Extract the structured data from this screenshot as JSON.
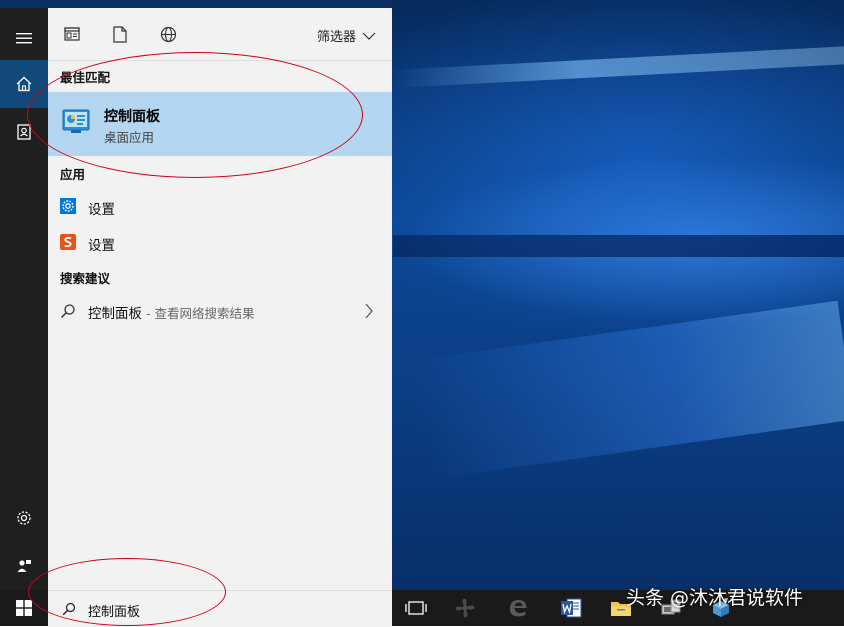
{
  "panel": {
    "filter_label": "筛选器",
    "best_match_heading": "最佳匹配",
    "apps_heading": "应用",
    "suggest_heading": "搜索建议"
  },
  "best_match": {
    "title": "控制面板",
    "subtitle": "桌面应用"
  },
  "apps": [
    {
      "label": "设置",
      "icon": "gear-icon",
      "color": "#0078d7"
    },
    {
      "label": "设置",
      "icon": "sogou-icon",
      "color": "#e8521d"
    }
  ],
  "suggestion": {
    "query": "控制面板",
    "hint": " - 查看网络搜索结果"
  },
  "search": {
    "value": "控制面板"
  },
  "watermark": {
    "text": "头条 @沐沐君说软件"
  },
  "colors": {
    "accent": "#114a7a",
    "highlight": "#b4d6f0",
    "annotation": "#d0021b"
  }
}
